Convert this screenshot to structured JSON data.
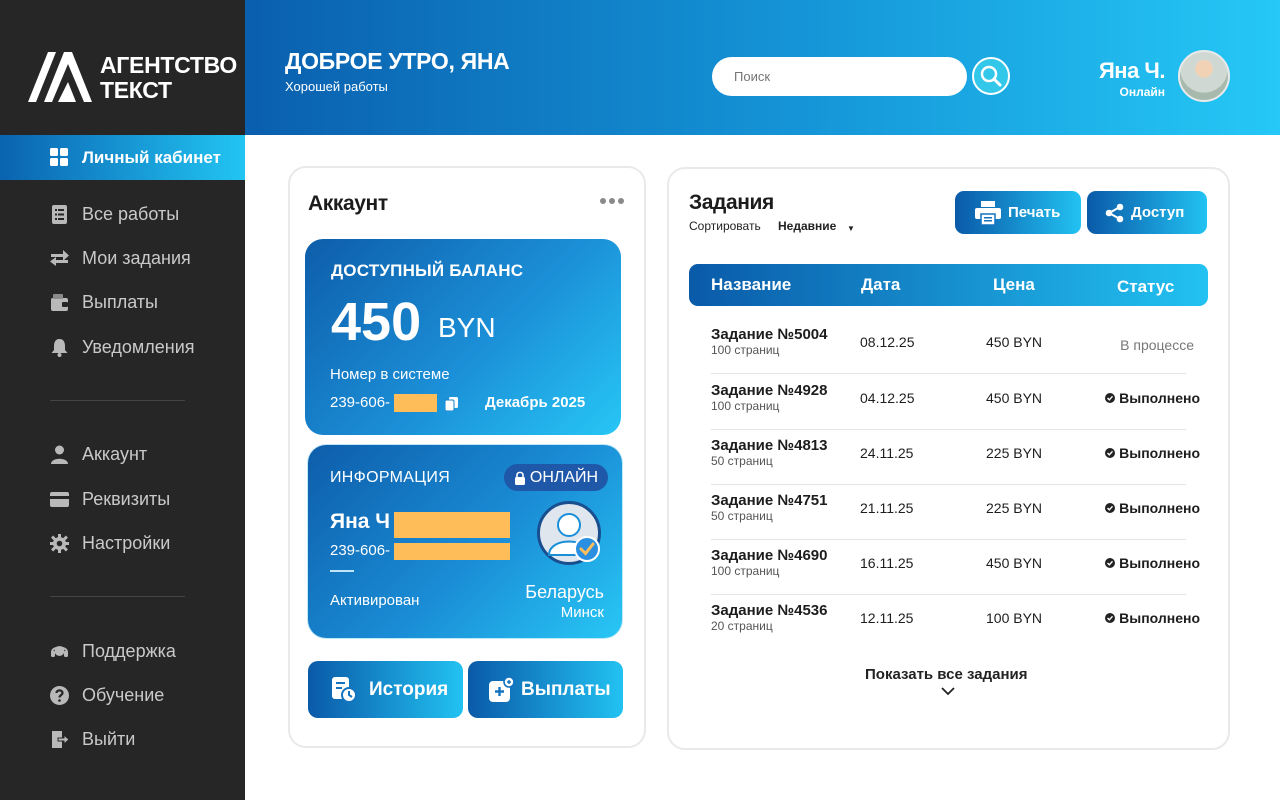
{
  "brand": {
    "line1": "АГЕНТСТВО",
    "line2": "ТЕКСТ"
  },
  "sidebar": {
    "active": {
      "label": "Личный кабинет",
      "icon": "grid-icon"
    },
    "items": [
      {
        "label": "Все работы",
        "icon": "list-icon"
      },
      {
        "label": "Мои задания",
        "icon": "swap-icon"
      },
      {
        "label": "Выплаты",
        "icon": "wallet-icon"
      },
      {
        "label": "Уведомления",
        "icon": "bell-icon"
      },
      {
        "label": "Аккаунт",
        "icon": "user-icon"
      },
      {
        "label": "Реквизиты",
        "icon": "card-icon"
      },
      {
        "label": "Настройки",
        "icon": "gear-icon"
      },
      {
        "label": "Поддержка",
        "icon": "headset-icon"
      },
      {
        "label": "Обучение",
        "icon": "question-icon"
      },
      {
        "label": "Выйти",
        "icon": "logout-icon"
      }
    ]
  },
  "header": {
    "greeting": "ДОБРОЕ УТРО, ЯНА",
    "subtitle": "Хорошей работы",
    "search_placeholder": "Поиск",
    "user_name": "Яна Ч.",
    "user_status": "Онлайн"
  },
  "account": {
    "title": "Аккаунт",
    "balance_caption": "ДОСТУПНЫЙ БАЛАНС",
    "balance_amount": "450",
    "balance_currency": "BYN",
    "system_label": "Номер в системе",
    "system_number": "239-606-",
    "month": "Декабрь 2025",
    "info_caption": "ИНФОРМАЦИЯ",
    "online_label": "ОНЛАЙН",
    "name": "Яна Ч",
    "phone": "239-606-",
    "status": "Активирован",
    "country": "Беларусь",
    "city": "Минск",
    "history_button": "История",
    "payouts_button": "Выплаты"
  },
  "tasks": {
    "title": "Задания",
    "sort_label": "Сортировать",
    "sort_value": "Недавние",
    "print_button": "Печать",
    "share_button": "Доступ",
    "columns": [
      "Название",
      "Дата",
      "Цена",
      "Статус"
    ],
    "rows": [
      {
        "name": "Задание №5004",
        "pages": "100 страниц",
        "date": "08.12.25",
        "price": "450 BYN",
        "status": "В процессе",
        "done": false
      },
      {
        "name": "Задание №4928",
        "pages": "100 страниц",
        "date": "04.12.25",
        "price": "450 BYN",
        "status": "Выполнено",
        "done": true
      },
      {
        "name": "Задание №4813",
        "pages": "50 страниц",
        "date": "24.11.25",
        "price": "225 BYN",
        "status": "Выполнено",
        "done": true
      },
      {
        "name": "Задание №4751",
        "pages": "50 страниц",
        "date": "21.11.25",
        "price": "225 BYN",
        "status": "Выполнено",
        "done": true
      },
      {
        "name": "Задание №4690",
        "pages": "100 страниц",
        "date": "16.11.25",
        "price": "450 BYN",
        "status": "Выполнено",
        "done": true
      },
      {
        "name": "Задание №4536",
        "pages": "20 страниц",
        "date": "12.11.25",
        "price": "100 BYN",
        "status": "Выполнено",
        "done": true
      }
    ],
    "show_all": "Показать все задания"
  },
  "colors": {
    "accent_start": "#0a5aa8",
    "accent_end": "#22c2f2",
    "sidebar_bg": "#262626",
    "redaction": "#ffbd59"
  }
}
